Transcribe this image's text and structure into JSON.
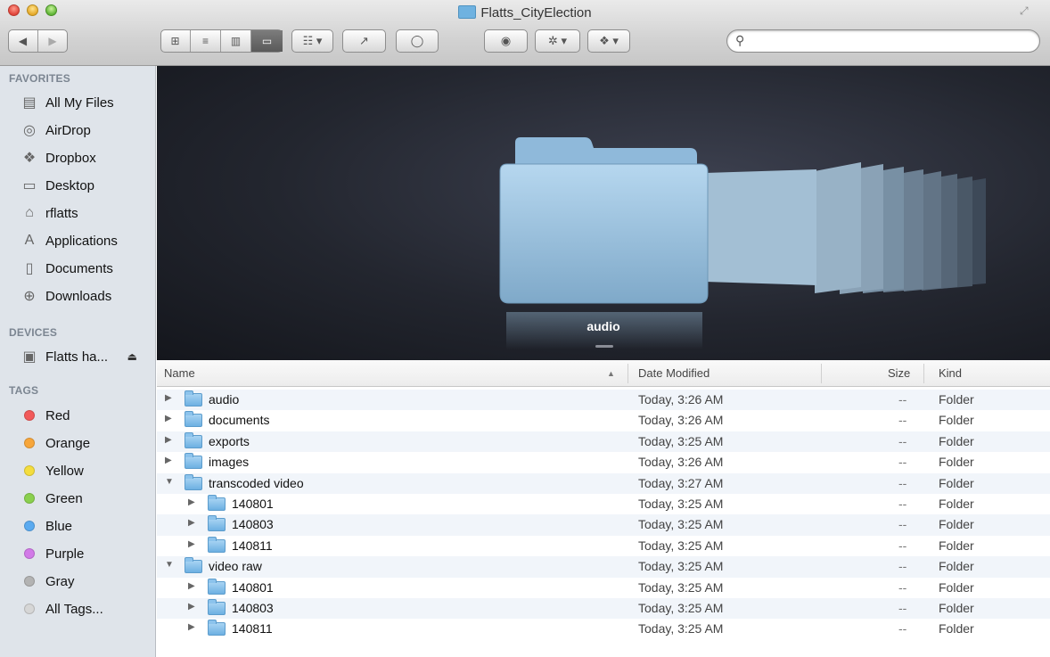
{
  "window": {
    "title": "Flatts_CityElection"
  },
  "toolbar": {
    "back_icon": "◀",
    "forward_icon": "▶",
    "view_icons": [
      "⊞",
      "≡",
      "▥",
      "▭"
    ],
    "arrange_icon": "☷ ▾",
    "share_icon": "↗",
    "tags_icon": "◯",
    "quicklook_icon": "◉",
    "action_icon": "✲ ▾",
    "dropbox_icon": "❖ ▾",
    "search_placeholder": "",
    "search_value": ""
  },
  "sidebar": {
    "favorites_header": "FAVORITES",
    "favorites": [
      {
        "label": "All My Files",
        "icon": "▤"
      },
      {
        "label": "AirDrop",
        "icon": "◎"
      },
      {
        "label": "Dropbox",
        "icon": "❖"
      },
      {
        "label": "Desktop",
        "icon": "▭"
      },
      {
        "label": "rflatts",
        "icon": "⌂"
      },
      {
        "label": "Applications",
        "icon": "A"
      },
      {
        "label": "Documents",
        "icon": "▯"
      },
      {
        "label": "Downloads",
        "icon": "⊕"
      }
    ],
    "devices_header": "DEVICES",
    "devices": [
      {
        "label": "Flatts ha...",
        "icon": "▣",
        "eject": "⏏"
      }
    ],
    "tags_header": "TAGS",
    "tags": [
      {
        "label": "Red",
        "color": "#f25a5a"
      },
      {
        "label": "Orange",
        "color": "#f7a63b"
      },
      {
        "label": "Yellow",
        "color": "#f4dd3e"
      },
      {
        "label": "Green",
        "color": "#8ad04e"
      },
      {
        "label": "Blue",
        "color": "#5aaaf0"
      },
      {
        "label": "Purple",
        "color": "#d27ae8"
      },
      {
        "label": "Gray",
        "color": "#b3b3b3"
      },
      {
        "label": "All Tags...",
        "color": "#d6d6d6"
      }
    ]
  },
  "coverflow": {
    "selected_label": "audio"
  },
  "list": {
    "columns": {
      "name": "Name",
      "sort_indicator": "▲",
      "date": "Date Modified",
      "size": "Size",
      "kind": "Kind"
    },
    "rows": [
      {
        "name": "audio",
        "indent": 0,
        "expanded": false,
        "date": "Today, 3:26 AM",
        "size": "--",
        "kind": "Folder"
      },
      {
        "name": "documents",
        "indent": 0,
        "expanded": false,
        "date": "Today, 3:26 AM",
        "size": "--",
        "kind": "Folder"
      },
      {
        "name": "exports",
        "indent": 0,
        "expanded": false,
        "date": "Today, 3:25 AM",
        "size": "--",
        "kind": "Folder"
      },
      {
        "name": "images",
        "indent": 0,
        "expanded": false,
        "date": "Today, 3:26 AM",
        "size": "--",
        "kind": "Folder"
      },
      {
        "name": "transcoded video",
        "indent": 0,
        "expanded": true,
        "date": "Today, 3:27 AM",
        "size": "--",
        "kind": "Folder"
      },
      {
        "name": "140801",
        "indent": 1,
        "expanded": false,
        "date": "Today, 3:25 AM",
        "size": "--",
        "kind": "Folder"
      },
      {
        "name": "140803",
        "indent": 1,
        "expanded": false,
        "date": "Today, 3:25 AM",
        "size": "--",
        "kind": "Folder"
      },
      {
        "name": "140811",
        "indent": 1,
        "expanded": false,
        "date": "Today, 3:25 AM",
        "size": "--",
        "kind": "Folder"
      },
      {
        "name": "video raw",
        "indent": 0,
        "expanded": true,
        "date": "Today, 3:25 AM",
        "size": "--",
        "kind": "Folder"
      },
      {
        "name": "140801",
        "indent": 1,
        "expanded": false,
        "date": "Today, 3:25 AM",
        "size": "--",
        "kind": "Folder"
      },
      {
        "name": "140803",
        "indent": 1,
        "expanded": false,
        "date": "Today, 3:25 AM",
        "size": "--",
        "kind": "Folder"
      },
      {
        "name": "140811",
        "indent": 1,
        "expanded": false,
        "date": "Today, 3:25 AM",
        "size": "--",
        "kind": "Folder"
      }
    ]
  }
}
